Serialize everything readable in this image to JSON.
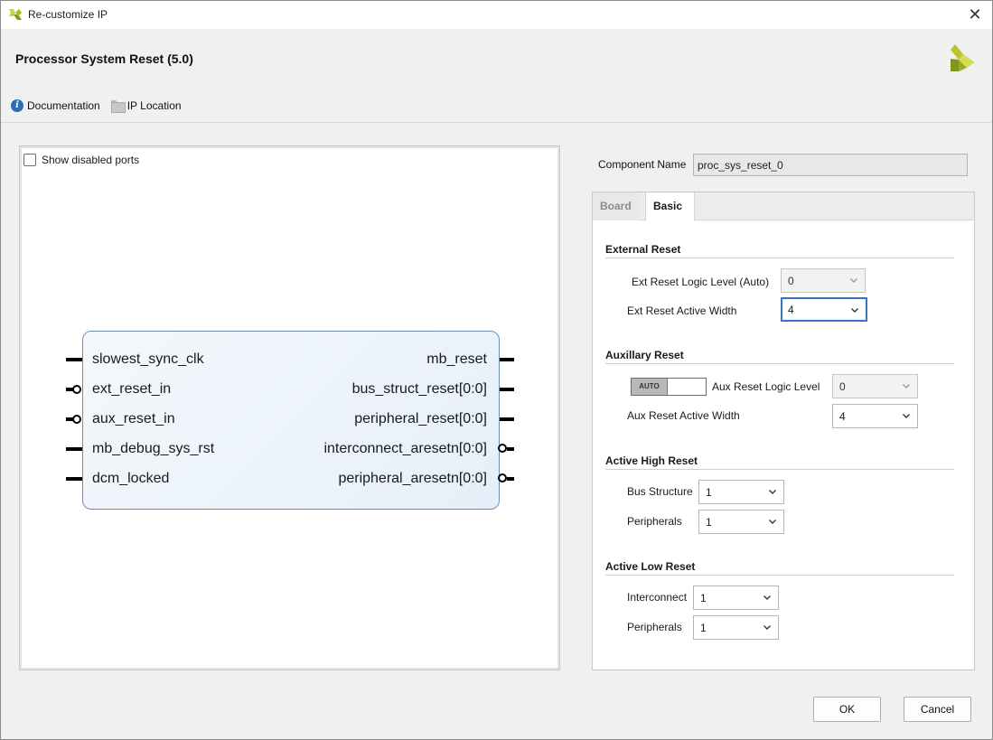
{
  "window": {
    "title": "Re-customize IP"
  },
  "header": {
    "ip_title": "Processor System Reset (5.0)",
    "links": {
      "documentation": "Documentation",
      "ip_location": "IP Location"
    }
  },
  "diagram": {
    "show_disabled_ports": "Show disabled ports",
    "left_ports": [
      "slowest_sync_clk",
      "ext_reset_in",
      "aux_reset_in",
      "mb_debug_sys_rst",
      "dcm_locked"
    ],
    "right_ports": [
      "mb_reset",
      "bus_struct_reset[0:0]",
      "peripheral_reset[0:0]",
      "interconnect_aresetn[0:0]",
      "peripheral_aresetn[0:0]"
    ]
  },
  "component": {
    "label": "Component Name",
    "value": "proc_sys_reset_0"
  },
  "tabs": {
    "board": "Board",
    "basic": "Basic"
  },
  "external_reset": {
    "title": "External Reset",
    "logic_level_label": "Ext Reset Logic Level (Auto)",
    "logic_level_value": "0",
    "active_width_label": "Ext Reset Active Width",
    "active_width_value": "4"
  },
  "aux_reset": {
    "title": "Auxillary Reset",
    "auto_label": "AUTO",
    "logic_level_label": "Aux Reset Logic Level",
    "logic_level_value": "0",
    "active_width_label": "Aux Reset Active Width",
    "active_width_value": "4"
  },
  "active_high": {
    "title": "Active High Reset",
    "bus_label": "Bus Structure",
    "bus_value": "1",
    "periph_label": "Peripherals",
    "periph_value": "1"
  },
  "active_low": {
    "title": "Active Low Reset",
    "interconnect_label": "Interconnect",
    "interconnect_value": "1",
    "periph_label": "Peripherals",
    "periph_value": "1"
  },
  "buttons": {
    "ok": "OK",
    "cancel": "Cancel"
  },
  "colors": {
    "accent": "#3474c2",
    "block_border": "#6f8db3",
    "brand_green": "#8ba21b"
  }
}
